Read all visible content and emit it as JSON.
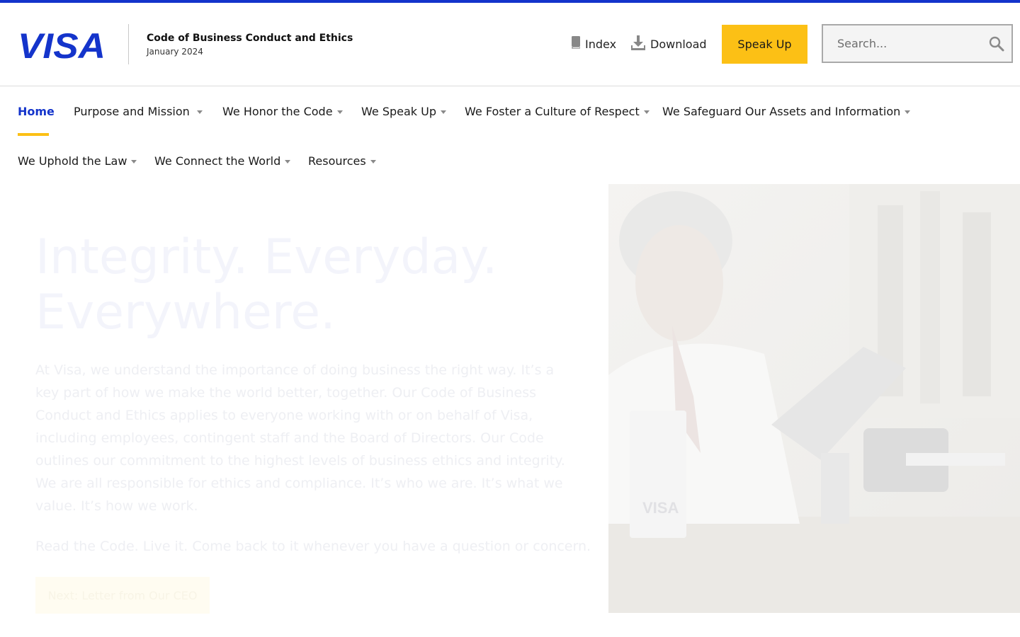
{
  "header": {
    "doc_title": "Code of Business Conduct and Ethics",
    "doc_date": "January 2024",
    "index_label": "Index",
    "download_label": "Download",
    "speak_up_label": "Speak Up",
    "search_placeholder": "Search..."
  },
  "nav": {
    "row1": [
      {
        "label": "Home"
      },
      {
        "label": "Purpose and Mission"
      },
      {
        "label": "We Honor the Code"
      },
      {
        "label": "We Speak Up"
      },
      {
        "label": "We Foster a Culture of Respect"
      },
      {
        "label": "We Safeguard Our Assets and Information"
      }
    ],
    "row2": [
      {
        "label": "We Uphold the Law"
      },
      {
        "label": "We Connect the World"
      },
      {
        "label": "Resources"
      }
    ]
  },
  "hero": {
    "title_line1": "Integrity. Everyday.",
    "title_line2": "Everywhere.",
    "body": "At Visa, we understand the importance of doing business the right way. It’s a key part of how we make the world better, together. Our Code of Business Conduct and Ethics applies to everyone working with or on behalf of Visa, including employees, contingent staff and the Board of Directors. Our Code outlines our commitment to the highest levels of business ethics and integrity. We are all responsible for ethics and compliance. It’s who we are. It’s what we value. It’s how we work.",
    "read_line": "Read the Code. Live it. Come back to it whenever you have a question or concern.",
    "cta_label": "Next: Letter from Our CEO"
  },
  "colors": {
    "brand_blue": "#1434cb",
    "accent_yellow": "#fcc015"
  },
  "icons": {
    "index": "book-icon",
    "download": "download-icon",
    "search": "search-icon"
  }
}
